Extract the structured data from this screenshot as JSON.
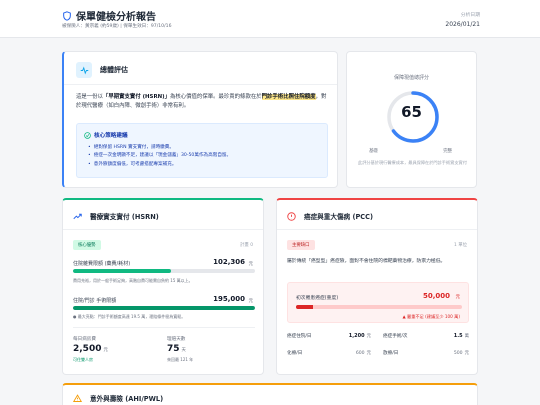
{
  "header": {
    "title": "保單健檢分析報告",
    "subtitle": "被保險人：黃宗義 (約59歲) | 保單生效日：97/10/16",
    "date_label": "分析日期",
    "date": "2026/01/21"
  },
  "summary": {
    "title": "總體評估",
    "text_1": "這是一份以",
    "text_bold": "「早期實支實付 (HSRN)」",
    "text_2": "為核心價值的保單。最珍貴的條款在於",
    "text_highlight": "門診手術比照住院額度",
    "text_3": "，對於現代醫療（如白內障、微創手術）非常有利。",
    "strategy_title": "核心策略建議",
    "strategy_items": [
      "絕對保留 HSRN 實支實付，請時繳費。",
      "癌症一次金明顯不足，建議以「現金儲蓄」30-50萬作為高階自留。",
      "意外險額度偏低，可考慮搭配專案補充。"
    ]
  },
  "score": {
    "label": "保障現值總評分",
    "value": "65",
    "value_pct": 65,
    "low_label": "基礎",
    "high_label": "完整",
    "note": "此評分基於現行醫療成本，最具保障在於門診手術實支實付"
  },
  "hsrn": {
    "title": "醫療實支實付 (HSRN)",
    "badge": "核心優勢",
    "badge_note": "計畫 0",
    "items": [
      {
        "label": "住院雜費限額 (藥費/耗材)",
        "value": "102,306",
        "unit": "元",
        "fill_pct": 54,
        "color": "#10b981",
        "note": "費用充裕，用於一般手術足夠，高階自費可能需自負約 15 萬以上。"
      },
      {
        "label": "住院/門診 手術限額",
        "value": "195,000",
        "unit": "元",
        "fill_pct": 100,
        "color": "#059669",
        "note": "● 最大亮點：門診手術額度高達 19.5 萬，理賠條件極為寬鬆。"
      }
    ],
    "stats": [
      {
        "label": "每日病房費",
        "value": "2,500",
        "unit": "元",
        "note": "可住雙人房",
        "note_color": "#059669"
      },
      {
        "label": "理賠天數",
        "value": "75",
        "unit": "天",
        "note": "來回最 121 年",
        "note_color": "#6b7280"
      }
    ]
  },
  "pcc": {
    "title": "癌症與重大傷病 (PCC)",
    "badge": "主要缺口",
    "badge_note": "1 單位",
    "desc": "屬於傳統「癌型型」癌症險，面對不會住院的標靶藥物治療，防禦力極低。",
    "gap_label": "初次罹患癌症(重度)",
    "gap_value": "50,000",
    "gap_unit": "元",
    "gap_fill_pct": 10,
    "gap_warn": "▲ 嚴重不足 (建議至少 100 萬)",
    "rows": [
      {
        "label": "癌症住院/日",
        "value": "1,200",
        "unit": "元",
        "bold": true
      },
      {
        "label": "癌症手術/次",
        "value": "1.5",
        "unit": "萬",
        "bold": true
      },
      {
        "label": "化療/日",
        "value": "600",
        "unit": "元",
        "bold": false
      },
      {
        "label": "放療/日",
        "value": "500",
        "unit": "元",
        "bold": false
      }
    ]
  },
  "bottom": {
    "title": "意外與壽險 (AHI/PWL)"
  },
  "colors": {
    "accent_blue": "#3b82f6",
    "green": "#10b981",
    "red": "#ef4444",
    "amber": "#f59e0b"
  }
}
